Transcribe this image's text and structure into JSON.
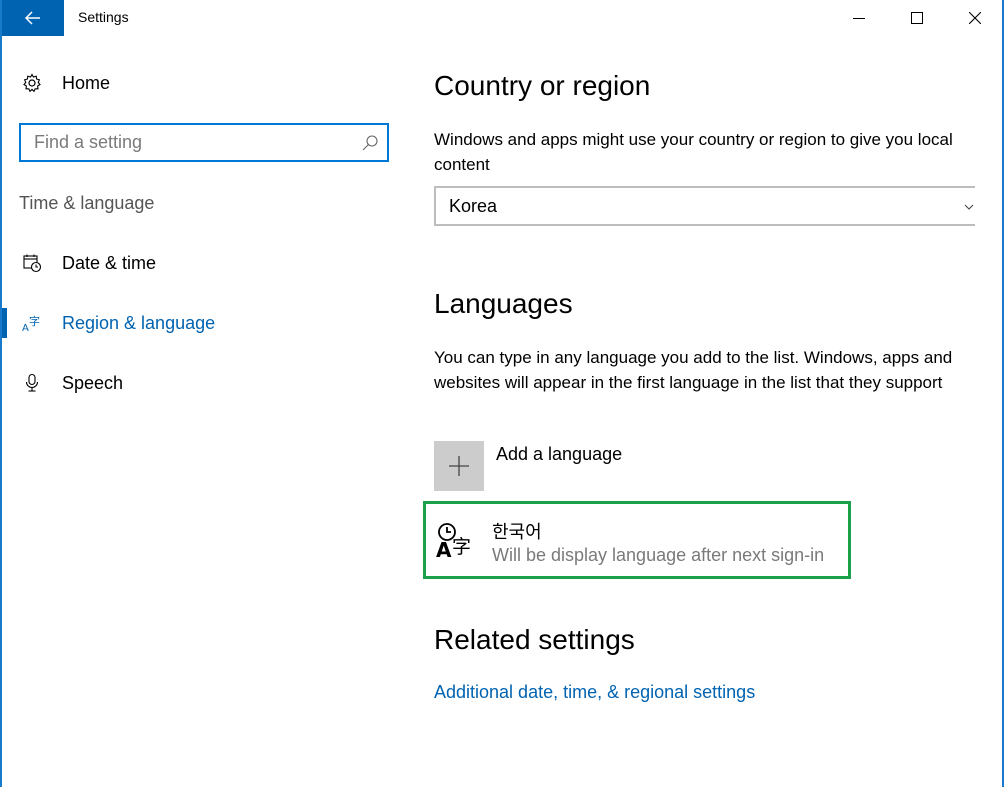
{
  "window": {
    "title": "Settings"
  },
  "sidebar": {
    "home_label": "Home",
    "search_placeholder": "Find a setting",
    "section_label": "Time & language",
    "items": [
      {
        "label": "Date & time",
        "icon": "calendar-clock-icon"
      },
      {
        "label": "Region & language",
        "icon": "region-language-icon",
        "active": true
      },
      {
        "label": "Speech",
        "icon": "microphone-icon"
      }
    ]
  },
  "main": {
    "country": {
      "heading": "Country or region",
      "description": "Windows and apps might use your country or region to give you local content",
      "selected": "Korea"
    },
    "languages": {
      "heading": "Languages",
      "description": "You can type in any language you add to the list. Windows, apps and websites will appear in the first language in the list that they support",
      "add_label": "Add a language",
      "list": [
        {
          "name": "한국어",
          "status": "Will be display language after next sign-in"
        }
      ]
    },
    "related": {
      "heading": "Related settings",
      "link": "Additional date, time, & regional settings"
    }
  },
  "colors": {
    "accent": "#0063b1",
    "highlight_border": "#1aa14a",
    "window_border": "#1979ca"
  }
}
